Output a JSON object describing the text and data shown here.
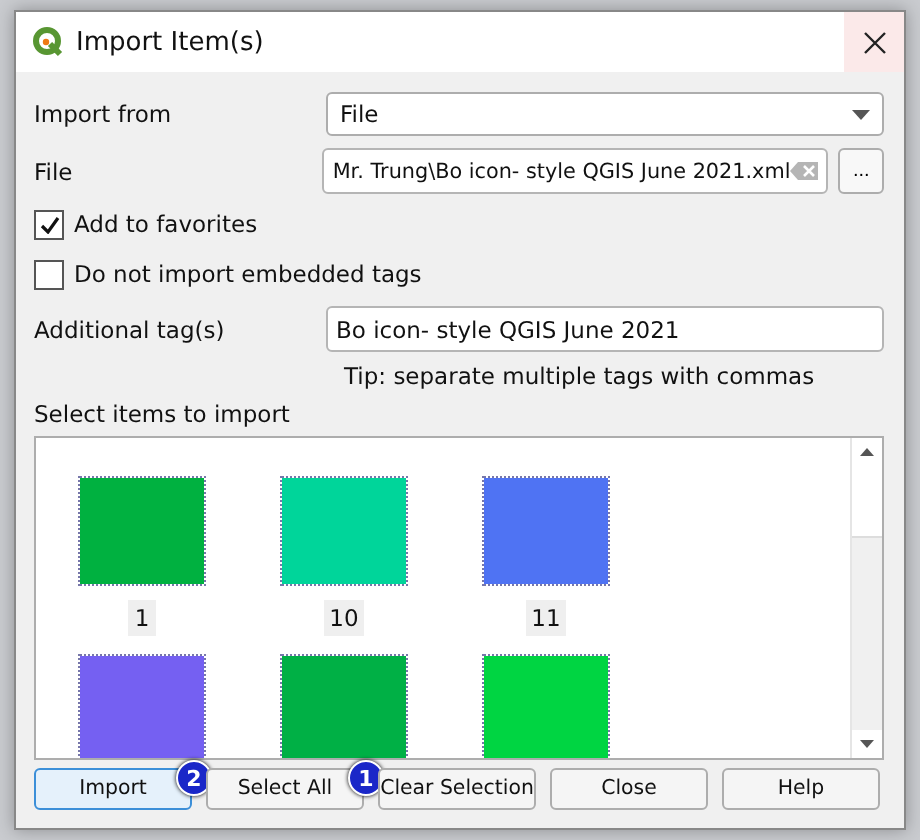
{
  "window": {
    "title": "Import Item(s)"
  },
  "form": {
    "import_from": {
      "label": "Import from",
      "value": "File"
    },
    "file": {
      "label": "File",
      "value": "Mr. Trung\\Bo icon- style QGIS June 2021.xml",
      "browse": "..."
    },
    "options": [
      {
        "label": "Add to favorites",
        "checked": true
      },
      {
        "label": "Do not import embedded tags",
        "checked": false
      }
    ],
    "tags": {
      "label": "Additional tag(s)",
      "value": "Bo icon- style QGIS June 2021"
    },
    "tip": "Tip: separate multiple tags with commas"
  },
  "items": {
    "label": "Select items to import",
    "list": [
      {
        "label": "1",
        "color": "#00b140"
      },
      {
        "label": "10",
        "color": "#00d59a"
      },
      {
        "label": "11",
        "color": "#4f73f3"
      },
      {
        "color": "#7560f2"
      },
      {
        "color": "#00b045"
      },
      {
        "color": "#00d542"
      }
    ]
  },
  "buttons": [
    {
      "label": "Import",
      "default": true,
      "badge": "2"
    },
    {
      "label": "Select All",
      "default": false,
      "badge": "1"
    },
    {
      "label": "Clear Selection",
      "default": false
    },
    {
      "label": "Close",
      "default": false
    },
    {
      "label": "Help",
      "default": false
    }
  ]
}
